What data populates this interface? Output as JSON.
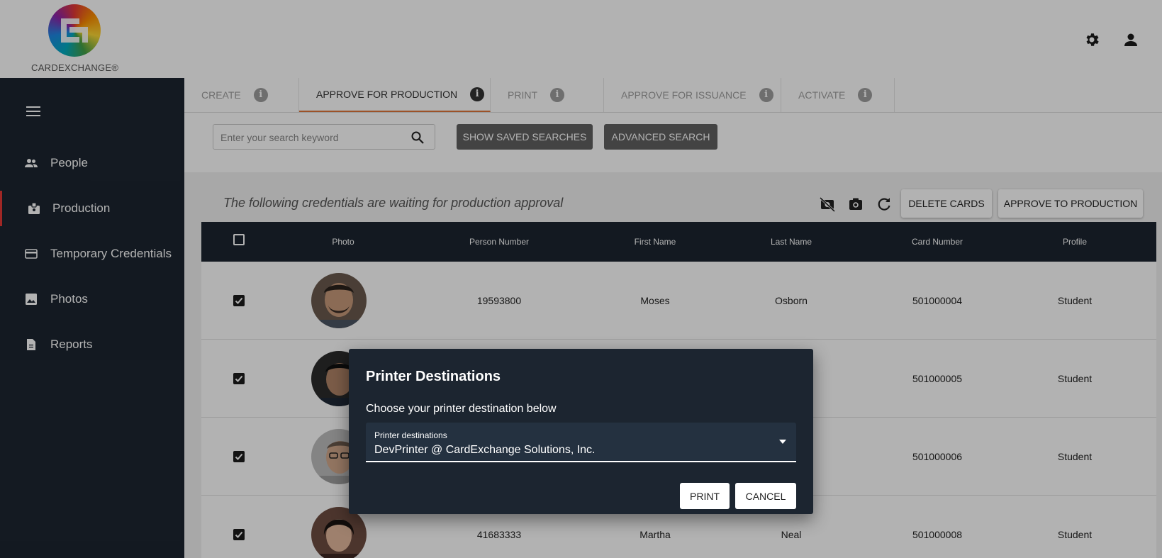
{
  "brand": {
    "name": "CARDEXCHANGE®"
  },
  "header": {
    "settings_icon": "gear-icon",
    "account_icon": "person-icon"
  },
  "sidebar": {
    "menu_icon": "hamburger-icon",
    "items": [
      {
        "label": "People",
        "icon": "people-icon",
        "active": false
      },
      {
        "label": "Production",
        "icon": "badge-icon",
        "active": true
      },
      {
        "label": "Temporary Credentials",
        "icon": "credit-card-icon",
        "active": false
      },
      {
        "label": "Photos",
        "icon": "image-icon",
        "active": false
      },
      {
        "label": "Reports",
        "icon": "document-icon",
        "active": false
      }
    ]
  },
  "tabs": [
    {
      "label": "CREATE",
      "active": false
    },
    {
      "label": "APPROVE FOR PRODUCTION",
      "active": true
    },
    {
      "label": "PRINT",
      "active": false
    },
    {
      "label": "APPROVE FOR ISSUANCE",
      "active": false
    },
    {
      "label": "ACTIVATE",
      "active": false
    }
  ],
  "search": {
    "placeholder": "Enter your search keyword",
    "value": "",
    "saved_label": "SHOW SAVED SEARCHES",
    "advanced_label": "ADVANCED SEARCH"
  },
  "content": {
    "heading": "The following credentials are waiting for production approval",
    "delete_label": "DELETE CARDS",
    "approve_label": "APPROVE TO PRODUCTION"
  },
  "table": {
    "columns": [
      "Photo",
      "Person Number",
      "First Name",
      "Last Name",
      "Card Number",
      "Profile"
    ],
    "rows": [
      {
        "checked": true,
        "person_number": "19593800",
        "first_name": "Moses",
        "last_name": "Osborn",
        "card_number": "501000004",
        "profile": "Student"
      },
      {
        "checked": true,
        "person_number": "",
        "first_name": "",
        "last_name": "",
        "card_number": "501000005",
        "profile": "Student"
      },
      {
        "checked": true,
        "person_number": "",
        "first_name": "",
        "last_name": "",
        "card_number": "501000006",
        "profile": "Student"
      },
      {
        "checked": true,
        "person_number": "41683333",
        "first_name": "Martha",
        "last_name": "Neal",
        "card_number": "501000008",
        "profile": "Student"
      }
    ]
  },
  "dialog": {
    "title": "Printer Destinations",
    "subtitle": "Choose your printer destination below",
    "select_label": "Printer destinations",
    "select_value": "DevPrinter @ CardExchange Solutions, Inc.",
    "print_label": "PRINT",
    "cancel_label": "CANCEL"
  },
  "colors": {
    "sidebar": "#1c2530",
    "accent": "#e53935",
    "tab_underline": "#e0763a"
  }
}
